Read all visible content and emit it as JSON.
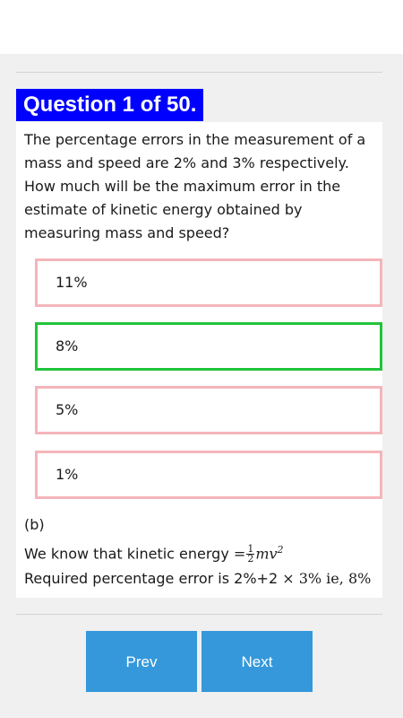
{
  "question": {
    "header": "Question 1 of 50.",
    "text": "The percentage errors in the measurement of a mass and speed are 2% and 3% respectively. How much will be the maximum error in the estimate of kinetic energy obtained by measuring mass and speed?"
  },
  "options": [
    {
      "label": "11%",
      "state": "wrong"
    },
    {
      "label": "8%",
      "state": "correct"
    },
    {
      "label": "5%",
      "state": "wrong"
    },
    {
      "label": "1%",
      "state": "wrong"
    }
  ],
  "explanation": {
    "answer": "(b)",
    "line1_text": "We know that kinetic energy",
    "line1_math_eq": "=",
    "line1_frac_num": "1",
    "line1_frac_den": "2",
    "line1_math_tail": "mv",
    "line1_math_exp": "2",
    "line2_text": "Required percentage error is 2%+2",
    "line2_math": "× 3% ie, 8%"
  },
  "nav": {
    "prev_label": "Prev",
    "next_label": "Next"
  },
  "colors": {
    "header_bg": "#0000ff",
    "option_border": "#f4b5ba",
    "correct_border": "#21c43a",
    "button_bg": "#3598db"
  }
}
